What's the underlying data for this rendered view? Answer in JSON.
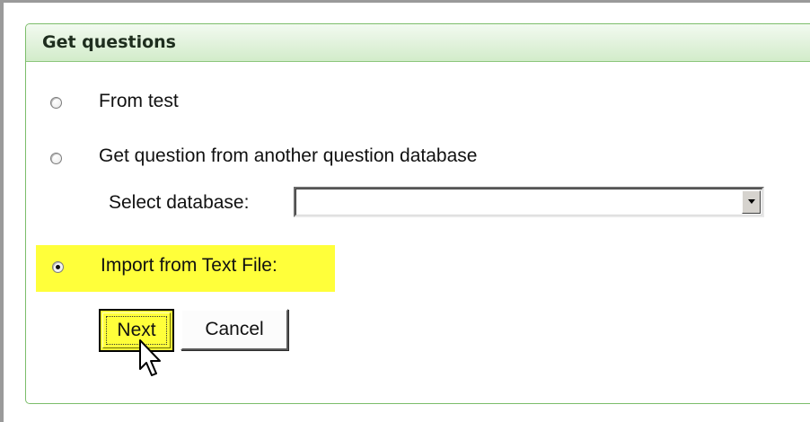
{
  "panel": {
    "title": "Get questions"
  },
  "options": [
    {
      "label": "From test",
      "selected": false
    },
    {
      "label": "Get question from another question database",
      "selected": false
    },
    {
      "label": "Import from Text File:",
      "selected": true,
      "highlighted": true
    }
  ],
  "database_select": {
    "label": "Select database:",
    "value": ""
  },
  "buttons": {
    "next": "Next",
    "cancel": "Cancel"
  },
  "colors": {
    "highlight": "#ffff3a",
    "panel_border": "#7cbd6b",
    "header_gradient_top": "#f2faf0",
    "header_gradient_bottom": "#d2ecca"
  }
}
